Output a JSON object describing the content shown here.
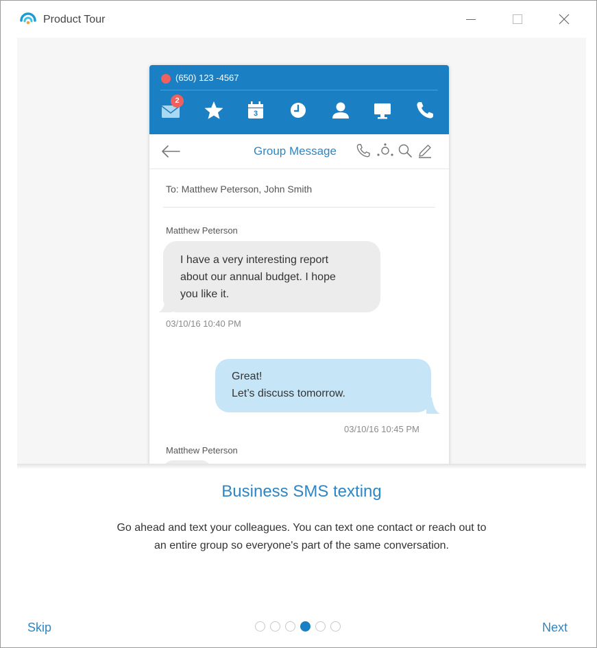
{
  "window": {
    "title": "Product Tour"
  },
  "phone": {
    "number": "(650) 123 -4567",
    "unread_badge": "2",
    "calendar_day": "3",
    "toolbar_title": "Group Message",
    "recipients": "To: Matthew Peterson, John Smith",
    "messages": [
      {
        "direction": "incoming",
        "sender": "Matthew Peterson",
        "lines": [
          "I have a very interesting report",
          "about our annual budget. I hope",
          "you like it."
        ],
        "timestamp": "03/10/16 10:40 PM"
      },
      {
        "direction": "outgoing",
        "lines": [
          "Great!",
          "Let’s discuss tomorrow."
        ],
        "timestamp": "03/10/16 10:45 PM"
      },
      {
        "direction": "incoming",
        "sender": "Matthew Peterson"
      }
    ]
  },
  "tour": {
    "heading": "Business SMS texting",
    "description_lines": [
      "Go ahead and text your colleagues. You can text one contact or reach out to",
      "an entire group so everyone's part of the same conversation."
    ],
    "skip_label": "Skip",
    "next_label": "Next",
    "steps_total": 6,
    "current_step": 4
  },
  "colors": {
    "brand_blue": "#1a7fc3",
    "accent_text": "#2d86c5",
    "badge_red": "#f0605e",
    "incoming_bubble": "#ececec",
    "outgoing_bubble": "#c6e5f7"
  },
  "icons": {
    "nav": [
      "messages-icon",
      "favorites-icon",
      "calendar-icon",
      "recents-icon",
      "contacts-icon",
      "meetings-icon",
      "phone-icon"
    ],
    "toolbar": [
      "call-icon",
      "add-participant-icon",
      "search-icon",
      "compose-icon"
    ]
  }
}
